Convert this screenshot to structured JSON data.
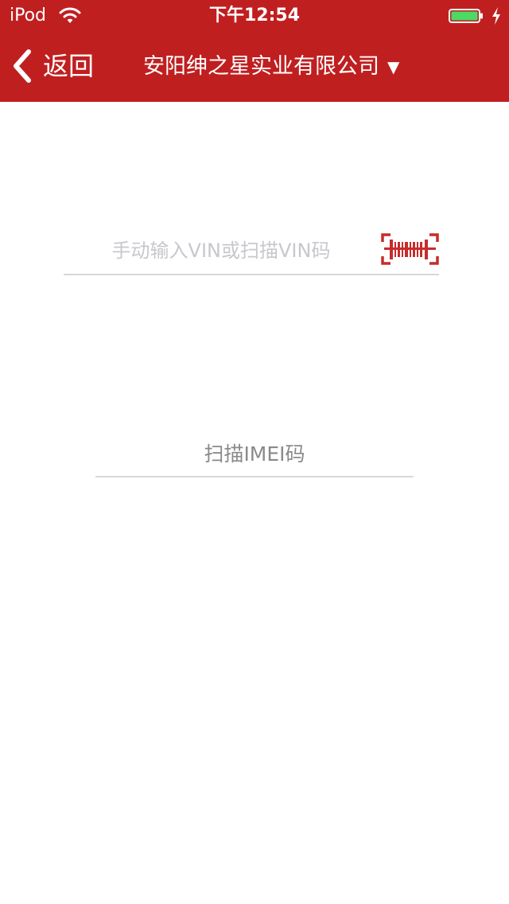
{
  "status_bar": {
    "carrier": "iPod",
    "time": "下午12:54",
    "battery_color": "#4cd964"
  },
  "nav": {
    "back_label": "返回",
    "title": "安阳绅之星实业有限公司",
    "caret": "▼",
    "bar_color": "#c01f20"
  },
  "vin": {
    "placeholder": "手动输入VIN或扫描VIN码",
    "value": "",
    "scan_icon": "barcode-scan-icon"
  },
  "imei": {
    "label": "扫描IMEI码"
  }
}
